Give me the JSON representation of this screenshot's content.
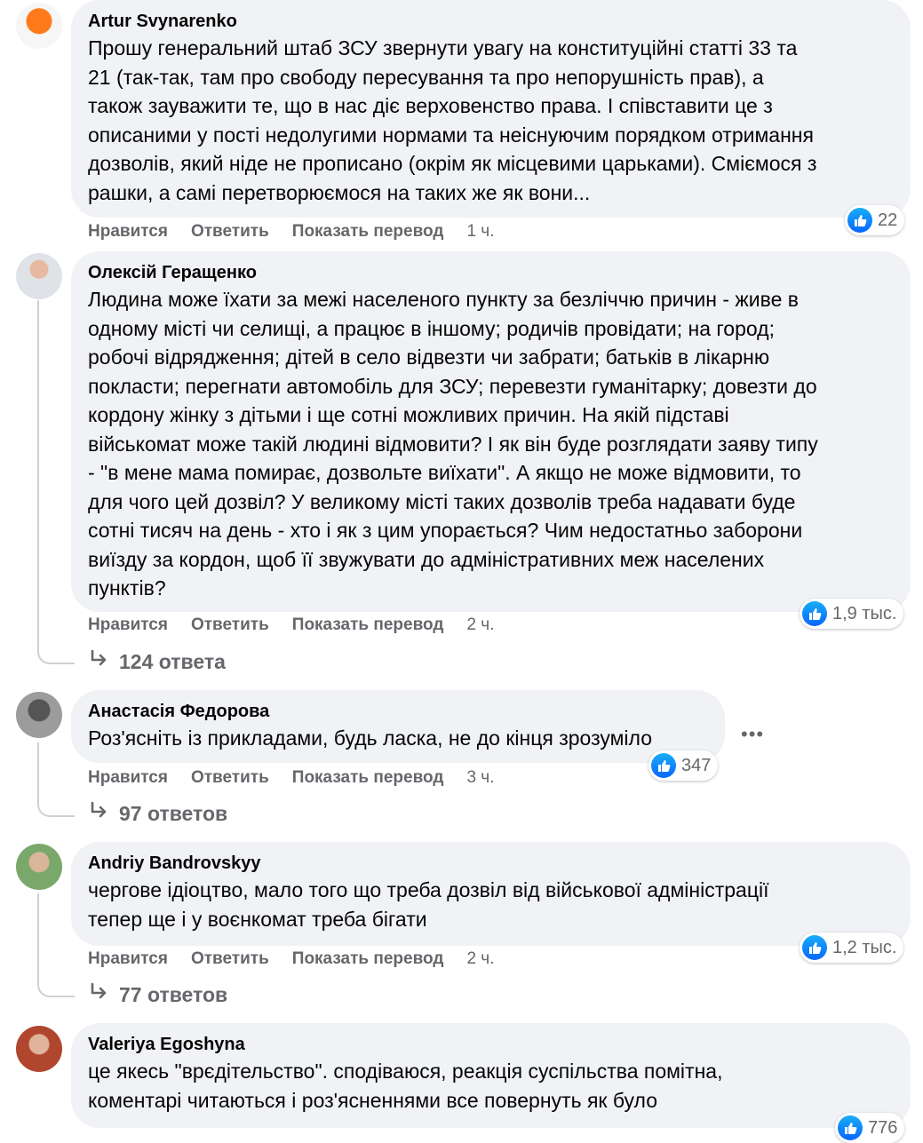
{
  "ui": {
    "like_label": "Нравится",
    "reply_label": "Ответить",
    "translate_label": "Показать перевод"
  },
  "comments": [
    {
      "author": "Artur Svynarenko",
      "text": "Прошу генеральний штаб ЗСУ звернути увагу на конституційні статті 33 та\n21 (так-так, там про свободу пересування та про непорушність прав), а\nтакож зауважити те, що в нас діє верховенство права. І співставити це з\nописаними у пості недолугими нормами та неіснуючим порядком отримання\nдозволів, який ніде не прописано (окрім як місцевими царьками). Сміємося з\nрашки, а самі перетворюємося на таких же як вони...",
      "time": "1 ч.",
      "reactions": "22"
    },
    {
      "author": "Олексій Геращенко",
      "text": "Людина може їхати за межі населеного пункту за безліччю причин - живе в\nодному місті чи селищі, а працює в іншому; родичів провідати; на город;\nробочі відрядження; дітей в село відвезти чи забрати; батьків в лікарню\nпокласти; перегнати автомобіль для ЗСУ; перевезти гуманітарку; довезти до\nкордону жінку з дітьми і ще сотні можливих причин. На якій підставі\nвійськомат може такій людині відмовити? І як він буде розглядати заяву типу\n- \"в мене мама помирає, дозвольте виїхати\". А якщо не може відмовити, то\nдля чого цей дозвіл? У великому місті таких дозволів треба надавати буде\nсотні тисяч на день - хто і як з цим упорається? Чим недостатньо заборони\nвиїзду за кордон, щоб її звужувати до адміністративних меж населених\nпунктів?",
      "time": "2 ч.",
      "reactions": "1,9 тыс.",
      "replies": "124 ответа"
    },
    {
      "author": "Анастасія Федорова",
      "text": "Роз'ясніть із прикладами, будь ласка, не до кінця зрозуміло",
      "time": "3 ч.",
      "reactions": "347",
      "replies": "97 ответов"
    },
    {
      "author": "Andriy Bandrovskyy",
      "text": "чергове ідіоцтво, мало того що треба дозвіл від військової адміністрації\nтепер ще і у воєнкомат треба бігати",
      "time": "2 ч.",
      "reactions": "1,2 тыс.",
      "replies": "77 ответов"
    },
    {
      "author": "Valeriya Egoshyna",
      "text": "це якесь \"врєдітельство\". сподіваюся, реакція суспільства помітна,\nкоментарі читаються і роз'ясненнями все повернуть як було",
      "reactions": "776"
    }
  ],
  "colors": {
    "bubble": "#f0f2f5",
    "meta": "#65676b",
    "like_blue": "#0866ff"
  }
}
